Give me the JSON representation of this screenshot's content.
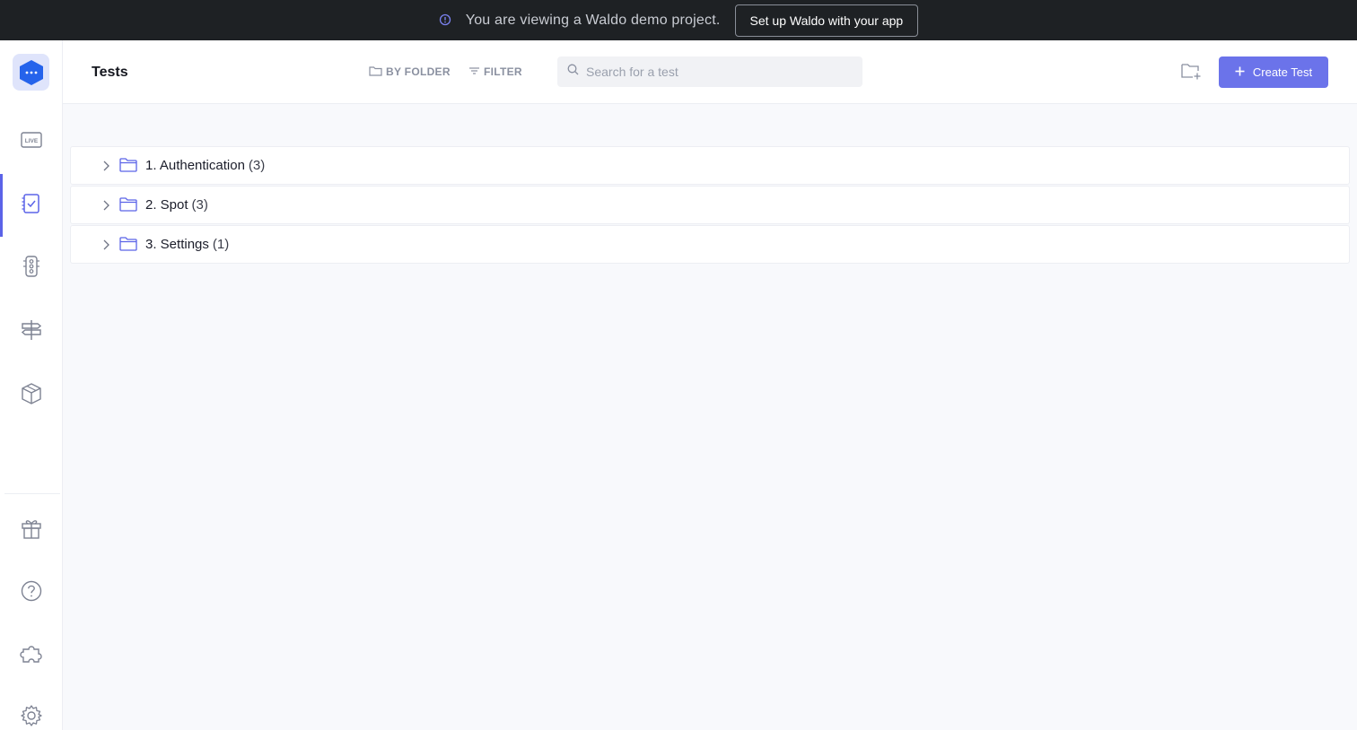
{
  "banner": {
    "message": "You are viewing a Waldo demo project.",
    "button_label": "Set up Waldo with your app"
  },
  "sidebar": {
    "items": [
      {
        "name": "live",
        "icon": "live-icon",
        "label": "LIVE"
      },
      {
        "name": "tests",
        "icon": "checklist-icon",
        "active": true
      },
      {
        "name": "runs",
        "icon": "traffic-light-icon"
      },
      {
        "name": "flows",
        "icon": "signpost-icon"
      },
      {
        "name": "builds",
        "icon": "box-icon"
      },
      {
        "name": "whats-new",
        "icon": "gift-icon"
      },
      {
        "name": "help",
        "icon": "help-circle-icon"
      },
      {
        "name": "integrations",
        "icon": "puzzle-icon"
      },
      {
        "name": "settings",
        "icon": "gear-icon"
      }
    ]
  },
  "header": {
    "title": "Tests",
    "by_folder_label": "BY FOLDER",
    "filter_label": "FILTER",
    "search_placeholder": "Search for a test",
    "create_label": "Create Test"
  },
  "folders": [
    {
      "name": "1. Authentication",
      "count": "(3)"
    },
    {
      "name": "2. Spot",
      "count": "(3)"
    },
    {
      "name": "3. Settings",
      "count": "(1)"
    }
  ],
  "colors": {
    "accent": "#6b73ea",
    "banner_bg": "#1e2124",
    "sidebar_active": "#5b63e8"
  }
}
